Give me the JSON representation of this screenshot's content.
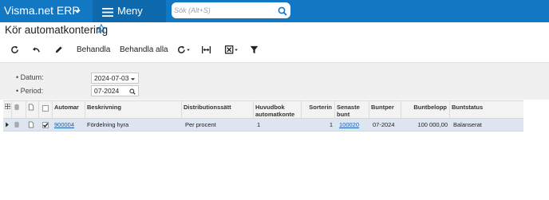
{
  "app": {
    "title": "Visma.net ERP"
  },
  "menu": {
    "label": "Meny"
  },
  "search": {
    "placeholder": "Sök (Alt+S)"
  },
  "page": {
    "title": "Kör automatkontering"
  },
  "toolbar": {
    "process_label": "Behandla",
    "process_all_label": "Behandla alla"
  },
  "filter": {
    "date_label": "Datum:",
    "date_value": "2024-07-03",
    "period_label": "Period:",
    "period_value": "07-2024"
  },
  "grid": {
    "headers": {
      "auto": "Automar",
      "description": "Beskrivning",
      "distribution": "Distributionssätt",
      "ledger": "Huvudbok automatkonte",
      "sort": "Sorterin",
      "last_batch": "Senaste bunt",
      "batch_period": "Buntper",
      "batch_amount": "Buntbelopp",
      "batch_status": "Buntstatus"
    },
    "rows": [
      {
        "selected": true,
        "auto": "900004",
        "description": "Fördelning hyra",
        "distribution": "Per procent",
        "ledger": "1",
        "sort": "1",
        "last_batch": "100020",
        "batch_period": "07-2024",
        "batch_amount": "100 000,00",
        "batch_status": "Balanserat"
      }
    ]
  },
  "colors": {
    "topbar": "#1378c4",
    "menu": "#0f6aad",
    "selected_row": "#dde6f0",
    "link": "#1a5fb4"
  }
}
